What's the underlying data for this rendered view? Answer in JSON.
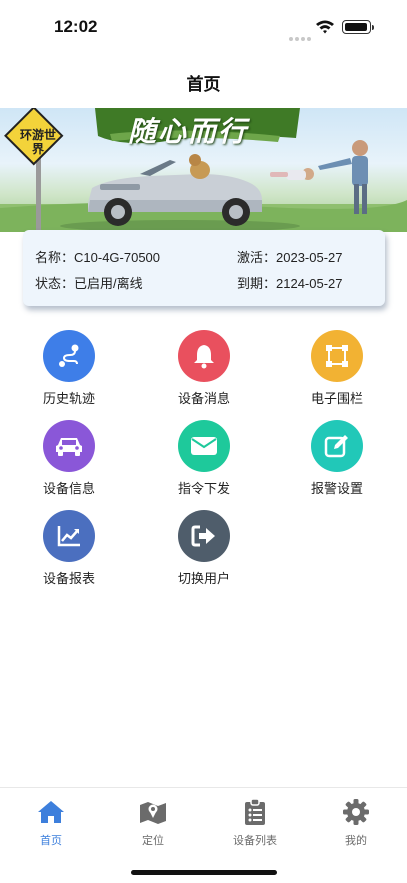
{
  "status_bar": {
    "time": "12:02"
  },
  "header": {
    "title": "首页"
  },
  "banner": {
    "slogan": "随心而行",
    "sign_text": "环游世界"
  },
  "device": {
    "name_label": "名称：",
    "name_value": "C10-4G-70500",
    "status_label": "状态：",
    "status_value": "已启用/离线",
    "activated_label": "激活：",
    "activated_value": "2023-05-27",
    "expires_label": "到期：",
    "expires_value": "2124-05-27"
  },
  "menu": [
    {
      "label": "历史轨迹",
      "icon": "route-icon",
      "color": "#3e7ee8"
    },
    {
      "label": "设备消息",
      "icon": "bell-icon",
      "color": "#e9505e"
    },
    {
      "label": "电子围栏",
      "icon": "fence-icon",
      "color": "#f2b233"
    },
    {
      "label": "设备信息",
      "icon": "car-icon",
      "color": "#8a57d8"
    },
    {
      "label": "指令下发",
      "icon": "envelope-icon",
      "color": "#1ec99b"
    },
    {
      "label": "报警设置",
      "icon": "edit-icon",
      "color": "#21c8b8"
    },
    {
      "label": "设备报表",
      "icon": "chart-icon",
      "color": "#4b6fbf"
    },
    {
      "label": "切换用户",
      "icon": "logout-icon",
      "color": "#4f5d6b"
    }
  ],
  "tabbar": {
    "items": [
      {
        "label": "首页",
        "icon": "home-icon",
        "active": true
      },
      {
        "label": "定位",
        "icon": "map-icon",
        "active": false
      },
      {
        "label": "设备列表",
        "icon": "clipboard-list-icon",
        "active": false
      },
      {
        "label": "我的",
        "icon": "gear-icon",
        "active": false
      }
    ]
  },
  "colors": {
    "accent": "#3d7fdc",
    "tab_inactive": "#6b6b6b",
    "card_bg": "#eef5fc"
  }
}
